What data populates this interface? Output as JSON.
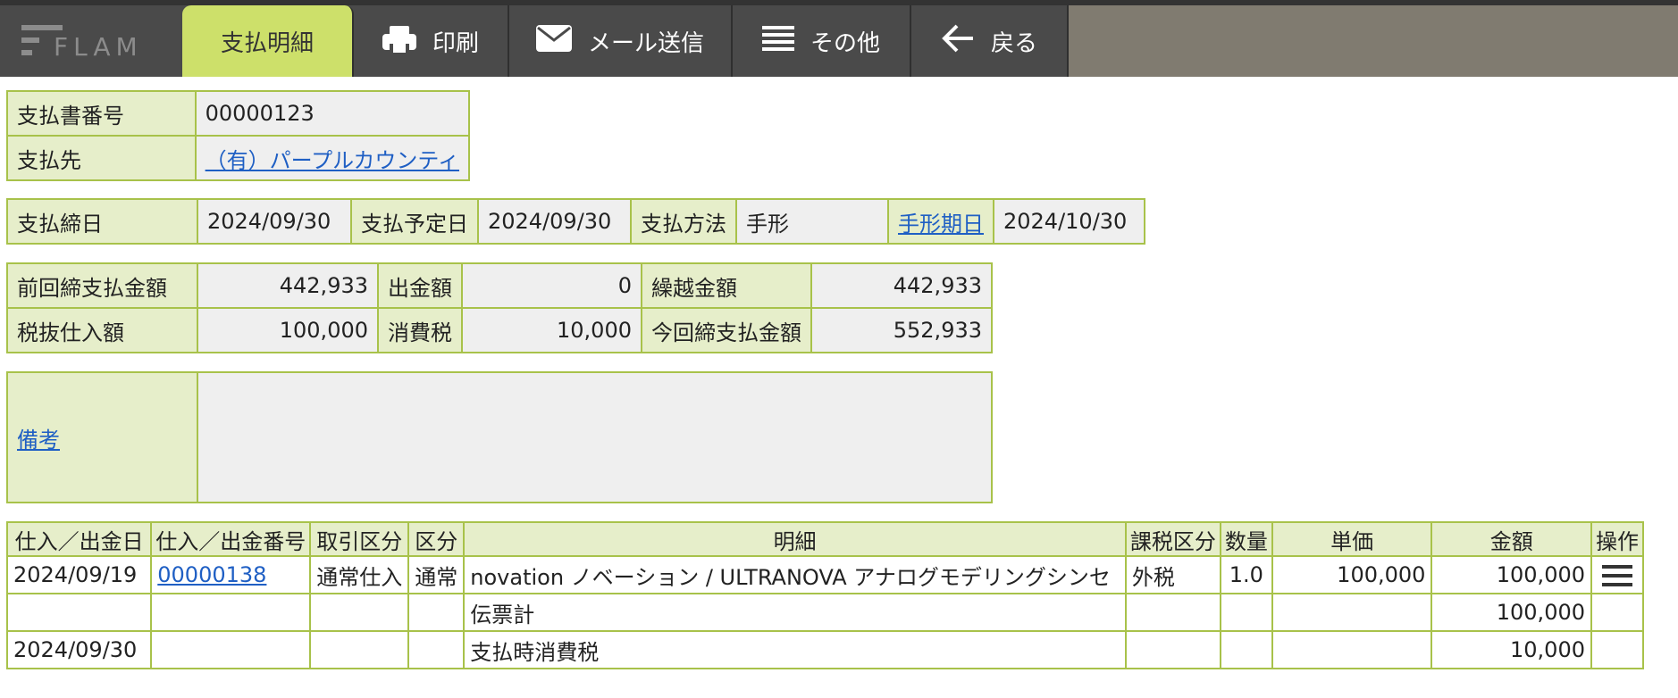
{
  "toolbar": {
    "logo_text": "FLAM",
    "tabs": [
      {
        "label": "支払明細",
        "icon": "none"
      },
      {
        "label": "印刷",
        "icon": "printer-icon"
      },
      {
        "label": "メール送信",
        "icon": "mail-icon"
      },
      {
        "label": "その他",
        "icon": "menu-icon"
      },
      {
        "label": "戻る",
        "icon": "back-arrow-icon"
      }
    ],
    "active_color": "#cde06a"
  },
  "header": {
    "invoice_no_label": "支払書番号",
    "invoice_no": "00000123",
    "payee_label": "支払先",
    "payee": "（有）パープルカウンティ"
  },
  "dates": {
    "close_label": "支払締日",
    "close": "2024/09/30",
    "scheduled_label": "支払予定日",
    "scheduled": "2024/09/30",
    "method_label": "支払方法",
    "method": "手形",
    "due_label": "手形期日",
    "due": "2024/10/30"
  },
  "amounts": {
    "prev_label": "前回締支払金額",
    "prev": "442,933",
    "out_label": "出金額",
    "out": "0",
    "carry_label": "繰越金額",
    "carry": "442,933",
    "net_purchase_label": "税抜仕入額",
    "net_purchase": "100,000",
    "tax_label": "消費税",
    "tax": "10,000",
    "current_label": "今回締支払金額",
    "current": "552,933"
  },
  "remarks": {
    "label": "備考",
    "value": ""
  },
  "detail": {
    "headers": [
      "仕入／出金日",
      "仕入／出金番号",
      "取引区分",
      "区分",
      "明細",
      "課税区分",
      "数量",
      "単価",
      "金額",
      "操作"
    ],
    "rows": [
      {
        "date": "2024/09/19",
        "number": "00000138",
        "trade": "通常仕入",
        "kind": "通常",
        "desc": "novation ノベーション / ULTRANOVA アナログモデリングシンセ",
        "tax": "外税",
        "qty": "1.0",
        "price": "100,000",
        "amount": "100,000"
      },
      {
        "date": "",
        "number": "",
        "trade": "",
        "kind": "",
        "desc": "伝票計",
        "tax": "",
        "qty": "",
        "price": "",
        "amount": "100,000"
      },
      {
        "date": "2024/09/30",
        "number": "",
        "trade": "",
        "kind": "",
        "desc": "支払時消費税",
        "tax": "",
        "qty": "",
        "price": "",
        "amount": "10,000"
      }
    ]
  }
}
